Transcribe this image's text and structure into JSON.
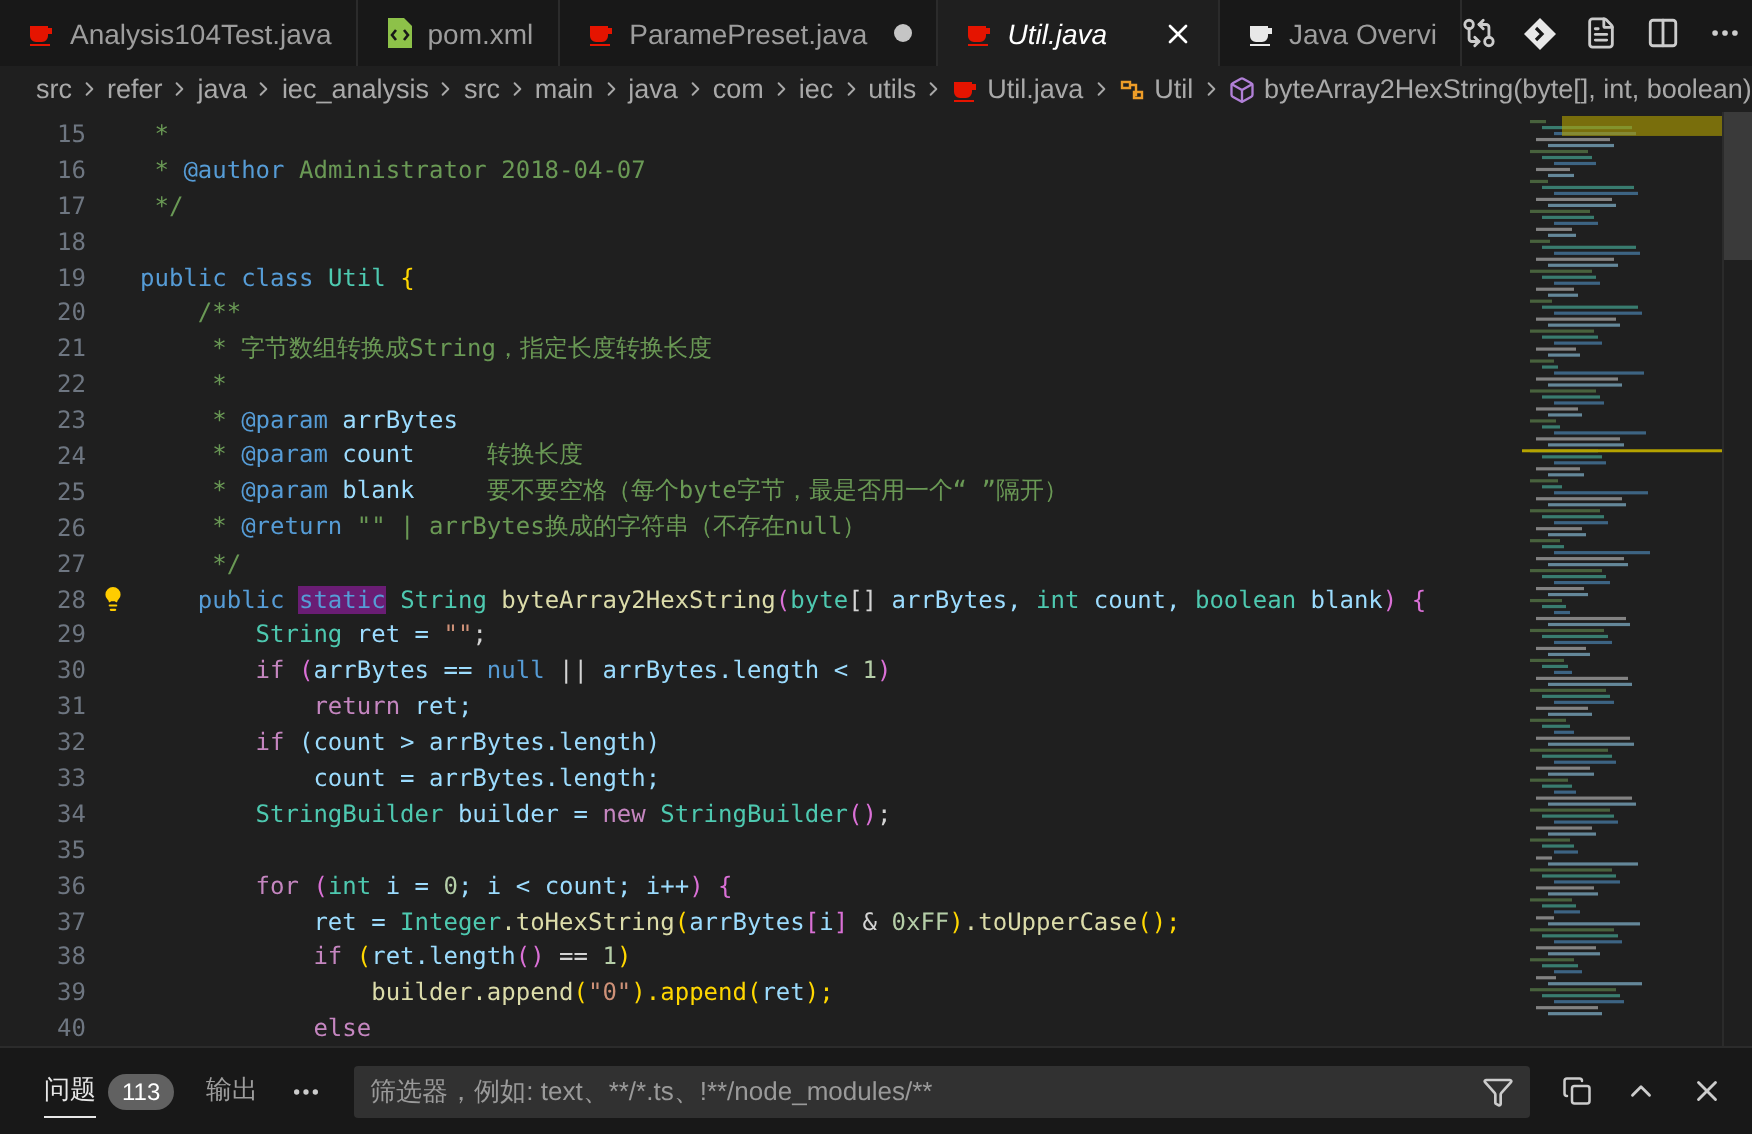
{
  "tabs": [
    {
      "label": "Analysis104Test.java",
      "kind": "java",
      "selected": false,
      "preview": false,
      "modified": false
    },
    {
      "label": "pom.xml",
      "kind": "xml",
      "selected": false,
      "preview": false,
      "modified": false
    },
    {
      "label": "ParamePreset.java",
      "kind": "java",
      "selected": false,
      "preview": false,
      "modified": true
    },
    {
      "label": "Util.java",
      "kind": "java",
      "selected": true,
      "preview": true,
      "modified": false
    },
    {
      "label": "Java Overvi",
      "kind": "overview",
      "selected": false,
      "preview": false,
      "modified": false
    }
  ],
  "breadcrumb": [
    {
      "label": "src",
      "kind": "folder"
    },
    {
      "label": "refer",
      "kind": "folder"
    },
    {
      "label": "java",
      "kind": "folder"
    },
    {
      "label": "iec_analysis",
      "kind": "folder"
    },
    {
      "label": "src",
      "kind": "folder"
    },
    {
      "label": "main",
      "kind": "folder"
    },
    {
      "label": "java",
      "kind": "folder"
    },
    {
      "label": "com",
      "kind": "folder"
    },
    {
      "label": "iec",
      "kind": "folder"
    },
    {
      "label": "utils",
      "kind": "folder"
    },
    {
      "label": "Util.java",
      "kind": "file"
    },
    {
      "label": "Util",
      "kind": "class"
    },
    {
      "label": "byteArray2HexString(byte[], int, boolean)",
      "kind": "method"
    }
  ],
  "code": [
    {
      "n": "15",
      "bulb": false,
      "tokens": [
        {
          "text": " *",
          "kind": "comment"
        }
      ]
    },
    {
      "n": "16",
      "bulb": false,
      "tokens": [
        {
          "text": " * ",
          "kind": "comment"
        },
        {
          "text": "@author",
          "kind": "doctag"
        },
        {
          "text": " Administrator 2018-04-07",
          "kind": "comment"
        }
      ]
    },
    {
      "n": "17",
      "bulb": false,
      "tokens": [
        {
          "text": " */",
          "kind": "comment"
        }
      ]
    },
    {
      "n": "18",
      "bulb": false
    },
    {
      "n": "19",
      "bulb": false,
      "tokens": [
        {
          "text": "public ",
          "kind": "keyword"
        },
        {
          "text": "class ",
          "kind": "keyword"
        },
        {
          "text": "Util ",
          "kind": "type"
        },
        {
          "text": "{",
          "kind": "bracket1"
        }
      ]
    },
    {
      "n": "20",
      "bulb": false,
      "tokens": [
        {
          "text": "    /**",
          "kind": "comment"
        }
      ]
    },
    {
      "n": "21",
      "bulb": false,
      "tokens": [
        {
          "text": "     * 字节数组转换成String，指定长度转换长度",
          "kind": "comment"
        }
      ]
    },
    {
      "n": "22",
      "bulb": false,
      "tokens": [
        {
          "text": "     *",
          "kind": "comment"
        }
      ]
    },
    {
      "n": "23",
      "bulb": false,
      "tokens": [
        {
          "text": "     * ",
          "kind": "comment"
        },
        {
          "text": "@param ",
          "kind": "doctag"
        },
        {
          "text": "arrBytes",
          "kind": "variable"
        }
      ]
    },
    {
      "n": "24",
      "bulb": false,
      "tokens": [
        {
          "text": "     * ",
          "kind": "comment"
        },
        {
          "text": "@param ",
          "kind": "doctag"
        },
        {
          "text": "count",
          "kind": "variable"
        },
        {
          "text": "     转换长度",
          "kind": "comment"
        }
      ]
    },
    {
      "n": "25",
      "bulb": false,
      "tokens": [
        {
          "text": "     * ",
          "kind": "comment"
        },
        {
          "text": "@param ",
          "kind": "doctag"
        },
        {
          "text": "blank",
          "kind": "variable"
        },
        {
          "text": "     要不要空格（每个byte字节，最是否用一个“ ”隔开）",
          "kind": "comment"
        }
      ]
    },
    {
      "n": "26",
      "bulb": false,
      "tokens": [
        {
          "text": "     * ",
          "kind": "comment"
        },
        {
          "text": "@return",
          "kind": "doctag"
        },
        {
          "text": " \"\" | arrBytes换成的字符串（不存在null）",
          "kind": "comment"
        }
      ]
    },
    {
      "n": "27",
      "bulb": false,
      "tokens": [
        {
          "text": "     */",
          "kind": "comment"
        }
      ]
    },
    {
      "n": "28",
      "bulb": true,
      "tokens": [
        {
          "text": "    public ",
          "kind": "keyword"
        },
        {
          "text": "static",
          "kind": "highlighted"
        },
        {
          "text": " String ",
          "kind": "type"
        },
        {
          "text": "byteArray2HexString",
          "kind": "function"
        },
        {
          "text": "(",
          "kind": "bracket2"
        },
        {
          "text": "byte",
          "kind": "primitive"
        },
        {
          "text": "[] ",
          "kind": "plain"
        },
        {
          "text": "arrBytes, ",
          "kind": "variable"
        },
        {
          "text": "int ",
          "kind": "primitive"
        },
        {
          "text": "count, ",
          "kind": "variable"
        },
        {
          "text": "boolean ",
          "kind": "primitive"
        },
        {
          "text": "blank",
          "kind": "variable"
        },
        {
          "text": ") {",
          "kind": "bracket2"
        }
      ]
    },
    {
      "n": "29",
      "bulb": false,
      "tokens": [
        {
          "text": "        String ",
          "kind": "type"
        },
        {
          "text": "ret = ",
          "kind": "variable"
        },
        {
          "text": "\"\"",
          "kind": "string"
        },
        {
          "text": ";",
          "kind": "plain"
        }
      ]
    },
    {
      "n": "30",
      "bulb": false,
      "tokens": [
        {
          "text": "        if ",
          "kind": "control"
        },
        {
          "text": "(",
          "kind": "bracket2"
        },
        {
          "text": "arrBytes == ",
          "kind": "variable"
        },
        {
          "text": "null ",
          "kind": "keyword"
        },
        {
          "text": "|| ",
          "kind": "plain"
        },
        {
          "text": "arrBytes.length < ",
          "kind": "variable"
        },
        {
          "text": "1",
          "kind": "number"
        },
        {
          "text": ")",
          "kind": "bracket2"
        }
      ]
    },
    {
      "n": "31",
      "bulb": false,
      "tokens": [
        {
          "text": "            return ",
          "kind": "control"
        },
        {
          "text": "ret;",
          "kind": "variable"
        }
      ]
    },
    {
      "n": "32",
      "bulb": false,
      "tokens": [
        {
          "text": "        if ",
          "kind": "control"
        },
        {
          "text": "(count > arrBytes.length)",
          "kind": "variable"
        }
      ]
    },
    {
      "n": "33",
      "bulb": false,
      "tokens": [
        {
          "text": "            count = arrBytes.length;",
          "kind": "variable"
        }
      ]
    },
    {
      "n": "34",
      "bulb": false,
      "tokens": [
        {
          "text": "        StringBuilder ",
          "kind": "type"
        },
        {
          "text": "builder = ",
          "kind": "variable"
        },
        {
          "text": "new ",
          "kind": "control"
        },
        {
          "text": "StringBuilder",
          "kind": "type"
        },
        {
          "text": "()",
          "kind": "bracket2"
        },
        {
          "text": ";",
          "kind": "plain"
        }
      ]
    },
    {
      "n": "35",
      "bulb": false
    },
    {
      "n": "36",
      "bulb": false,
      "tokens": [
        {
          "text": "        for ",
          "kind": "control"
        },
        {
          "text": "(",
          "kind": "bracket2"
        },
        {
          "text": "int ",
          "kind": "primitive"
        },
        {
          "text": "i = ",
          "kind": "variable"
        },
        {
          "text": "0",
          "kind": "number"
        },
        {
          "text": "; i < count; i++",
          "kind": "variable"
        },
        {
          "text": ") {",
          "kind": "bracket2"
        }
      ]
    },
    {
      "n": "37",
      "bulb": false,
      "tokens": [
        {
          "text": "            ret = ",
          "kind": "variable"
        },
        {
          "text": "Integer",
          "kind": "type"
        },
        {
          "text": ".toHexString",
          "kind": "function"
        },
        {
          "text": "(",
          "kind": "bracket1"
        },
        {
          "text": "arrBytes",
          "kind": "variable"
        },
        {
          "text": "[",
          "kind": "bracket2"
        },
        {
          "text": "i",
          "kind": "variable"
        },
        {
          "text": "]",
          "kind": "bracket2"
        },
        {
          "text": " & ",
          "kind": "plain"
        },
        {
          "text": "0xFF",
          "kind": "number"
        },
        {
          "text": ")",
          "kind": "bracket1"
        },
        {
          "text": ".toUpperCase",
          "kind": "function"
        },
        {
          "text": "();",
          "kind": "bracket1"
        }
      ]
    },
    {
      "n": "38",
      "bulb": false,
      "tokens": [
        {
          "text": "            if ",
          "kind": "control"
        },
        {
          "text": "(",
          "kind": "bracket1"
        },
        {
          "text": "ret.length",
          "kind": "variable"
        },
        {
          "text": "()",
          "kind": "bracket2"
        },
        {
          "text": " == ",
          "kind": "plain"
        },
        {
          "text": "1",
          "kind": "number"
        },
        {
          "text": ")",
          "kind": "bracket1"
        }
      ]
    },
    {
      "n": "39",
      "bulb": false,
      "tokens": [
        {
          "text": "                builder.append",
          "kind": "function"
        },
        {
          "text": "(",
          "kind": "bracket1"
        },
        {
          "text": "\"0\"",
          "kind": "string"
        },
        {
          "text": ").append(",
          "kind": "bracket1"
        },
        {
          "text": "ret",
          "kind": "variable"
        },
        {
          "text": ");",
          "kind": "bracket1"
        }
      ]
    },
    {
      "n": "40",
      "bulb": false,
      "tokens": [
        {
          "text": "            else",
          "kind": "control"
        }
      ]
    }
  ],
  "panel": {
    "tabs": [
      {
        "label": "问题",
        "badge": "113",
        "selected": true
      },
      {
        "label": "输出",
        "selected": false
      }
    ],
    "filter": {
      "placeholder": "筛选器，例如: text、**/*.ts、!**/node_modules/**"
    }
  }
}
